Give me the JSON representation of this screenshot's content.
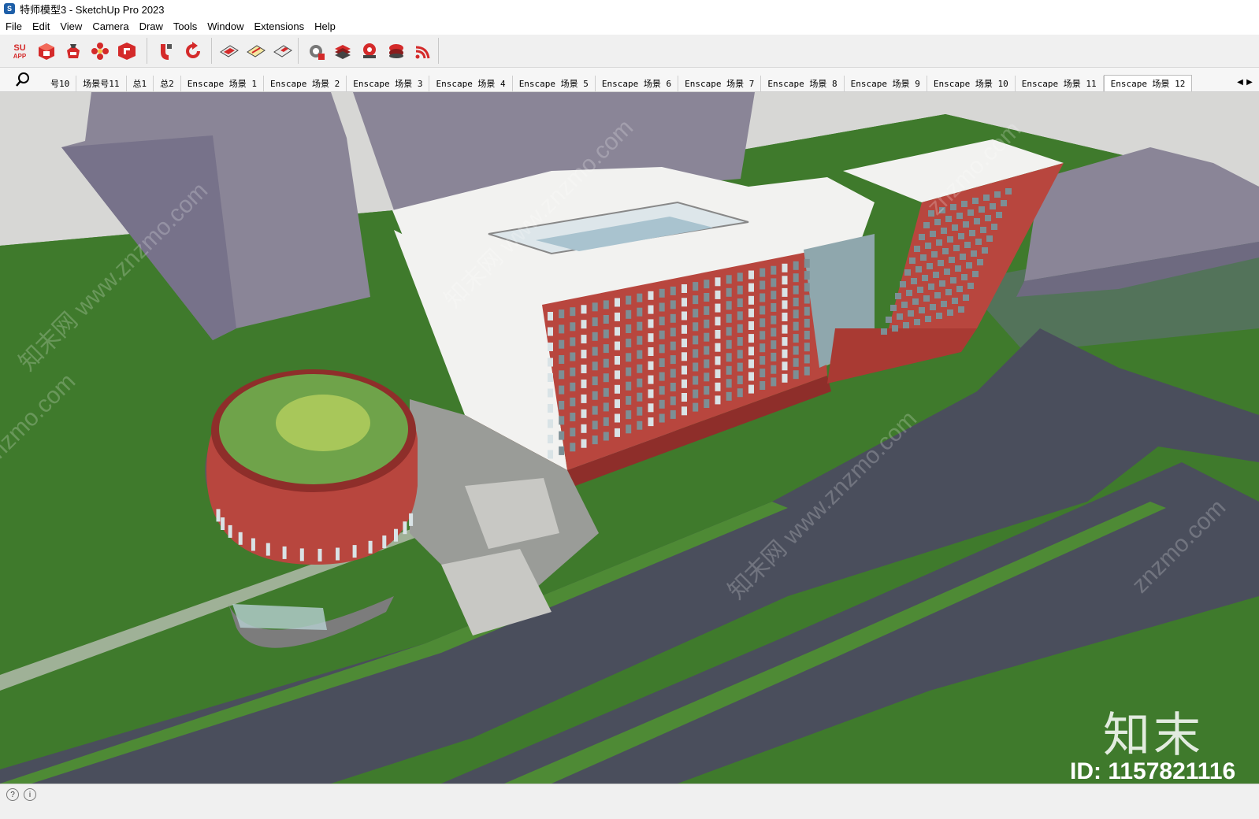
{
  "window": {
    "title": "特师模型3 - SketchUp Pro 2023",
    "app_icon_glyph": "S"
  },
  "menu": {
    "items": [
      "File",
      "Edit",
      "View",
      "Camera",
      "Draw",
      "Tools",
      "Window",
      "Extensions",
      "Help"
    ]
  },
  "toolbar": {
    "su_app_label_top": "SU",
    "su_app_label_bottom": "APP",
    "tools": [
      "su-app-icon",
      "warehouse-icon",
      "extension-warehouse-icon",
      "flower-icon",
      "layout-icon",
      "magnet-icon",
      "refresh-icon",
      "section-plane-icon",
      "section-fill-icon",
      "section-cut-icon",
      "settings-gear-icon",
      "book-icon",
      "gear-stack-icon",
      "layers-icon",
      "signal-icon"
    ],
    "accent_red": "#d42a2a"
  },
  "scenes": {
    "tabs": [
      "号10",
      "场景号11",
      "总1",
      "总2",
      "Enscape 场景 1",
      "Enscape 场景 2",
      "Enscape 场景 3",
      "Enscape 场景 4",
      "Enscape 场景 5",
      "Enscape 场景 6",
      "Enscape 场景 7",
      "Enscape 场景 8",
      "Enscape 场景 9",
      "Enscape 场景 10",
      "Enscape 场景 11",
      "Enscape 场景 12"
    ],
    "active_index": 15,
    "scroll_left": "◀",
    "scroll_right": "▶"
  },
  "viewport": {
    "watermark_brand": "知末",
    "watermark_id": "ID: 1157821116",
    "watermark_pattern_a": "知末网 www.znzmo.com",
    "watermark_pattern_b": "znzmo.com",
    "colors": {
      "grass": "#3f7a2c",
      "road": "#4a4e5c",
      "sky": "#d7d7d5",
      "building_red": "#b8463e",
      "building_white": "#f2f2f0",
      "tower_purple": "#8a8597"
    }
  },
  "status": {
    "icons": [
      "help-icon",
      "info-icon"
    ]
  }
}
